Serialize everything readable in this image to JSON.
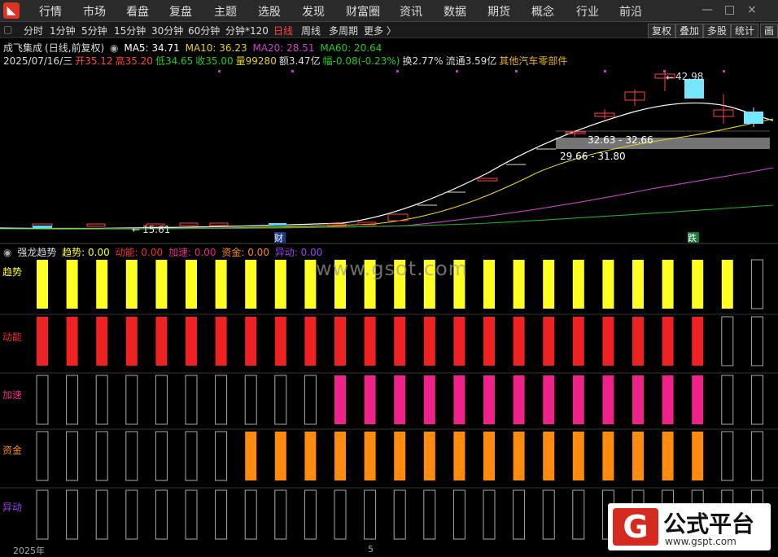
{
  "nav": {
    "items": [
      "行情",
      "市场",
      "看盘",
      "复盘",
      "主题",
      "选股",
      "发现",
      "财富圈",
      "资讯",
      "数据",
      "期货",
      "概念",
      "行业",
      "前沿"
    ],
    "win": [
      "—",
      "□",
      "×"
    ]
  },
  "periods": {
    "items": [
      "分时",
      "1分钟",
      "5分钟",
      "15分钟",
      "30分钟",
      "60分钟",
      "分钟*120",
      "日线",
      "周线",
      "多周期",
      "更多 〉"
    ],
    "active": "日线",
    "right_buttons": [
      "复权",
      "叠加",
      "多股",
      "统计",
      "画"
    ]
  },
  "stock": {
    "name": "成飞集成",
    "mode": "(日线,前复权)",
    "ma5": "MA5: 34.71",
    "ma10": "MA10: 36.23",
    "ma20": "MA20: 28.51",
    "ma60": "MA60: 20.64",
    "date": "2025/07/16/三",
    "open": "开35.12",
    "high": "高35.20",
    "low": "低34.65",
    "close": "收35.00",
    "volume": "量99280",
    "amount": "额3.47亿",
    "change": "幅-0.08(-0.23%)",
    "turnover": "换2.77%",
    "float": "流通3.59亿",
    "sector": "其他汽车零部件"
  },
  "chart_labels": {
    "high_mark": "42.98",
    "zone1": "32.63 - 32.66",
    "zone2": "29.66 - 31.80",
    "low_mark": "15.61",
    "cai": "财",
    "die": "跌"
  },
  "indicator": {
    "name": "强龙趋势",
    "v1": "趋势: 0.00",
    "v2": "动能: 0.00",
    "v3": "加速: 0.00",
    "v4": "资金: 0.00",
    "v5": "异动: 0.00",
    "rows": [
      "趋势",
      "动能",
      "加速",
      "资金",
      "异动"
    ]
  },
  "colors": {
    "trend": "#ffff22",
    "momentum": "#ee2222",
    "accel": "#ee2288",
    "fund": "#ff8a10",
    "ma5": "#ffffff",
    "ma10": "#e6d21e",
    "ma20": "#cc44cc",
    "ma60": "#22aa22"
  },
  "axis": {
    "year": "2025年",
    "month": "5"
  },
  "watermark": "www.gsot.com",
  "badge": {
    "g": "G",
    "title": "公式平台",
    "url": "www.gspt.com"
  }
}
